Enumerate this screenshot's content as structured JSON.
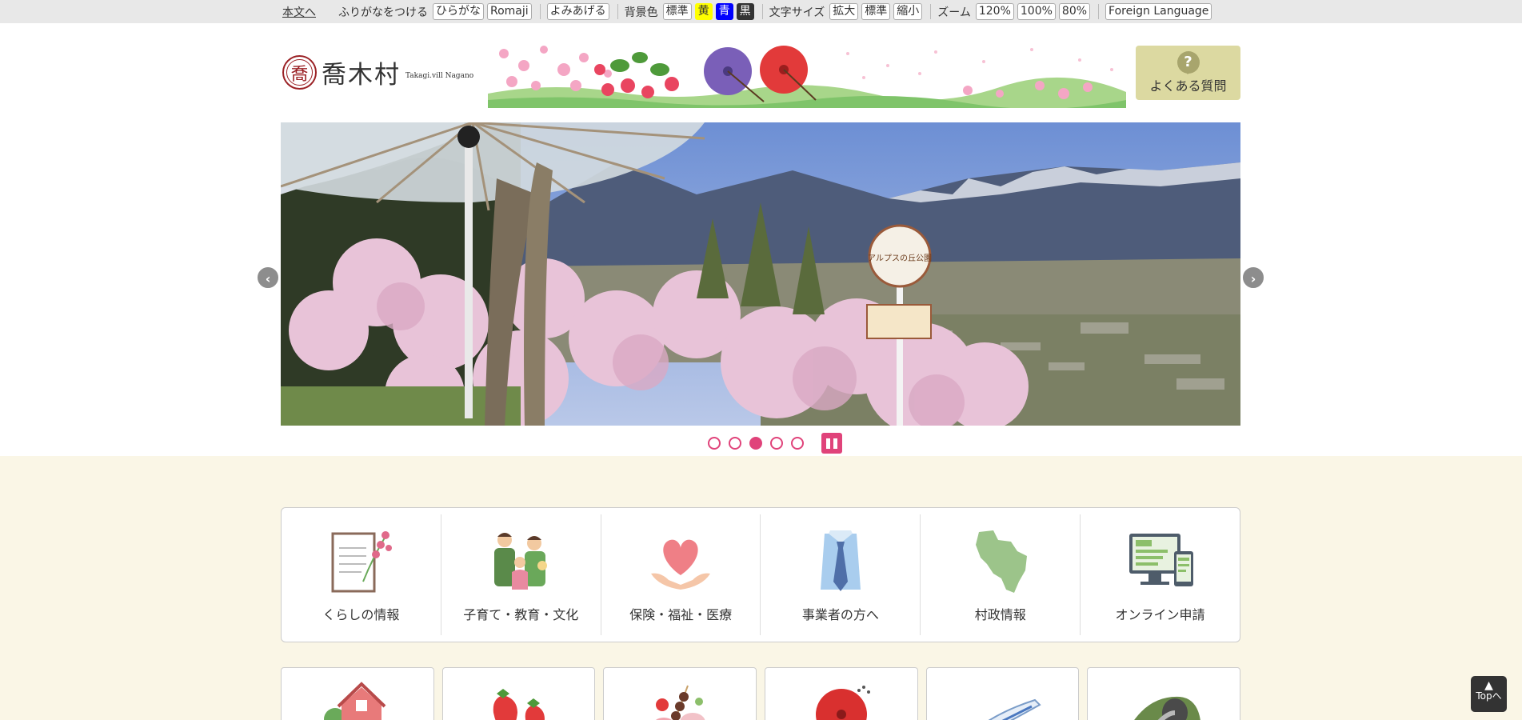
{
  "topbar": {
    "skip_link": "本文へ",
    "furigana_label": "ふりがなをつける",
    "hiragana_btn": "ひらがな",
    "romaji_btn": "Romaji",
    "read_aloud_btn": "よみあげる",
    "bgcolor_label": "背景色",
    "bg_standard": "標準",
    "bg_yellow": "黄",
    "bg_blue": "青",
    "bg_black": "黒",
    "fontsize_label": "文字サイズ",
    "font_large": "拡大",
    "font_standard": "標準",
    "font_small": "縮小",
    "zoom_label": "ズーム",
    "zoom_120": "120%",
    "zoom_100": "100%",
    "zoom_80": "80%",
    "foreign_btn": "Foreign Language"
  },
  "header": {
    "logo_seal": "喬",
    "logo_name": "喬木村",
    "logo_sub": "Takagi.vill Nagano",
    "faq_icon": "?",
    "faq_label": "よくある質問"
  },
  "slider": {
    "prev": "‹",
    "next": "›",
    "sign_text": "アルプスの丘公園",
    "active_index": 3,
    "total": 5
  },
  "categories": [
    {
      "label": "くらしの情報",
      "icon": "document-flower-icon"
    },
    {
      "label": "子育て・教育・文化",
      "icon": "family-icon"
    },
    {
      "label": "保険・福祉・医療",
      "icon": "heart-hands-icon"
    },
    {
      "label": "事業者の方へ",
      "icon": "shirt-tie-icon"
    },
    {
      "label": "村政情報",
      "icon": "village-map-icon"
    },
    {
      "label": "オンライン申請",
      "icon": "computer-devices-icon"
    }
  ],
  "row2": [
    {
      "icon": "house-icon"
    },
    {
      "icon": "strawberry-icon"
    },
    {
      "icon": "food-icon"
    },
    {
      "icon": "umbrella-icon"
    },
    {
      "icon": "train-icon"
    },
    {
      "icon": "tunnel-icon"
    }
  ],
  "top_button": {
    "arrow": "▲",
    "label": "Topへ"
  },
  "colors": {
    "accent_pink": "#e0437a",
    "cream_bg": "#faf6e6",
    "faq_bg": "#dcd9a1",
    "logo_red": "#9b2226"
  }
}
